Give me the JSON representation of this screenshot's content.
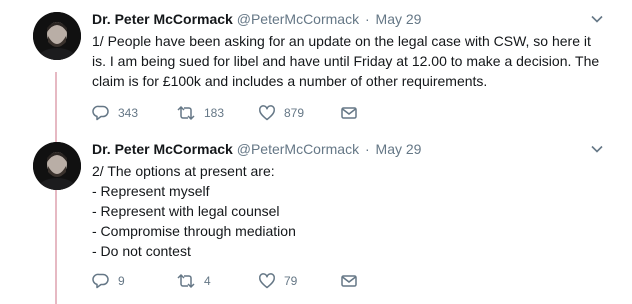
{
  "tweets": [
    {
      "name": "Dr. Peter McCormack",
      "handle": "@PeterMcCormack",
      "separator": "·",
      "date": "May 29",
      "lines": [
        "1/ People have been asking for an update on the legal case with CSW, so here it",
        "is. I am being sued for libel and have until Friday at 12.00 to make a decision. The",
        "claim is for £100k and includes a number of other requirements."
      ],
      "replies": "343",
      "retweets": "183",
      "likes": "879"
    },
    {
      "name": "Dr. Peter McCormack",
      "handle": "@PeterMcCormack",
      "separator": "·",
      "date": "May 29",
      "lines": [
        "2/ The options at present are:",
        "- Represent myself",
        "- Represent with legal counsel",
        "- Compromise through mediation",
        "- Do not contest"
      ],
      "replies": "9",
      "retweets": "4",
      "likes": "79"
    }
  ],
  "colors": {
    "text": "#14171a",
    "secondary": "#657786",
    "thread_line": "#e6b9c3"
  },
  "icons": [
    "reply-icon",
    "retweet-icon",
    "like-icon",
    "direct-message-icon",
    "chevron-down-icon"
  ]
}
